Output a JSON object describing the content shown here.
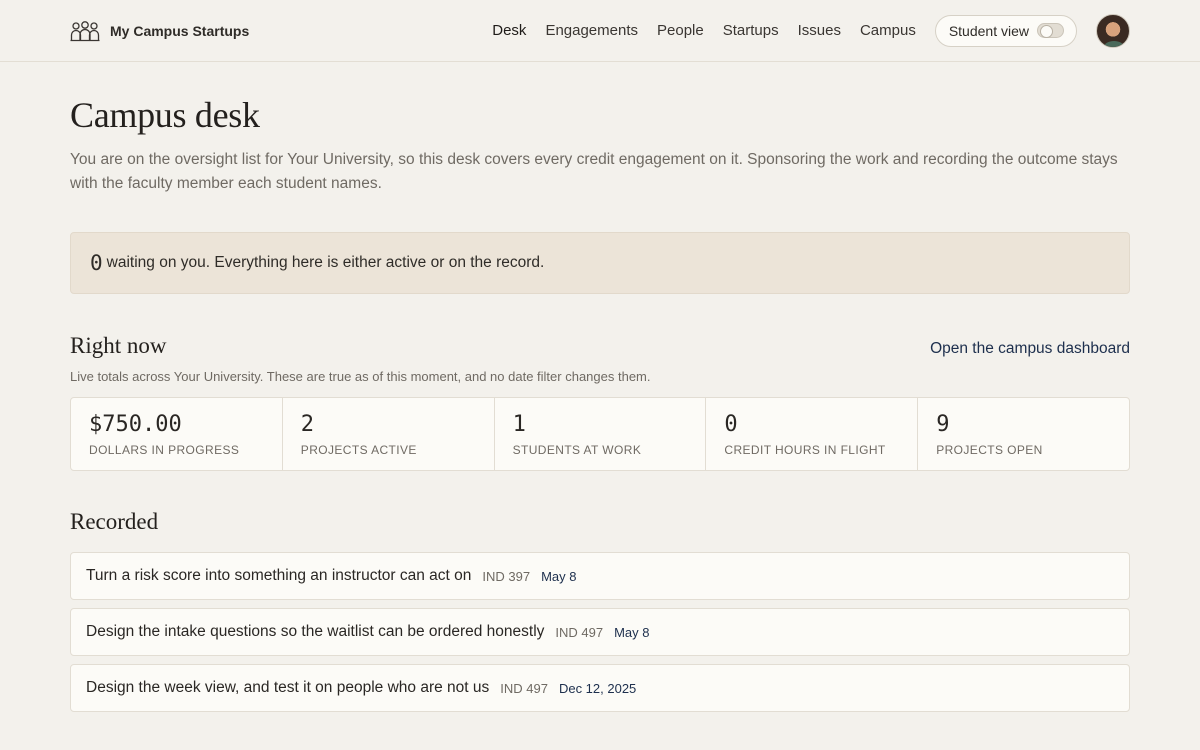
{
  "brand": {
    "name": "My Campus Startups",
    "icon": "people-group-icon"
  },
  "nav": {
    "items": [
      "Desk",
      "Engagements",
      "People",
      "Startups",
      "Issues",
      "Campus"
    ],
    "active": "Desk",
    "student_view_label": "Student view",
    "student_view_on": false
  },
  "page": {
    "title": "Campus desk",
    "intro": "You are on the oversight list for Your University, so this desk covers every credit engagement on it. Sponsoring the work and recording the outcome stays with the faculty member each student names."
  },
  "callout": {
    "count": "0",
    "text": "waiting on you. Everything here is either active or on the record."
  },
  "right_now": {
    "title": "Right now",
    "link": "Open the campus dashboard",
    "subtitle": "Live totals across Your University. These are true as of this moment, and no date filter changes them.",
    "stats": [
      {
        "value": "$750.00",
        "label": "Dollars in progress"
      },
      {
        "value": "2",
        "label": "Projects active"
      },
      {
        "value": "1",
        "label": "Students at work"
      },
      {
        "value": "0",
        "label": "Credit hours in flight"
      },
      {
        "value": "9",
        "label": "Projects open"
      }
    ]
  },
  "recorded": {
    "title": "Recorded",
    "items": [
      {
        "title": "Turn a risk score into something an instructor can act on",
        "code": "IND 397",
        "date": "May 8"
      },
      {
        "title": "Design the intake questions so the waitlist can be ordered honestly",
        "code": "IND 497",
        "date": "May 8"
      },
      {
        "title": "Design the week view, and test it on people who are not us",
        "code": "IND 497",
        "date": "Dec 12, 2025"
      }
    ]
  },
  "colors": {
    "background": "#f3f1ec",
    "callout_bg": "#ece4d8",
    "link": "#1d2f4d",
    "muted_text": "#6f6a63"
  }
}
